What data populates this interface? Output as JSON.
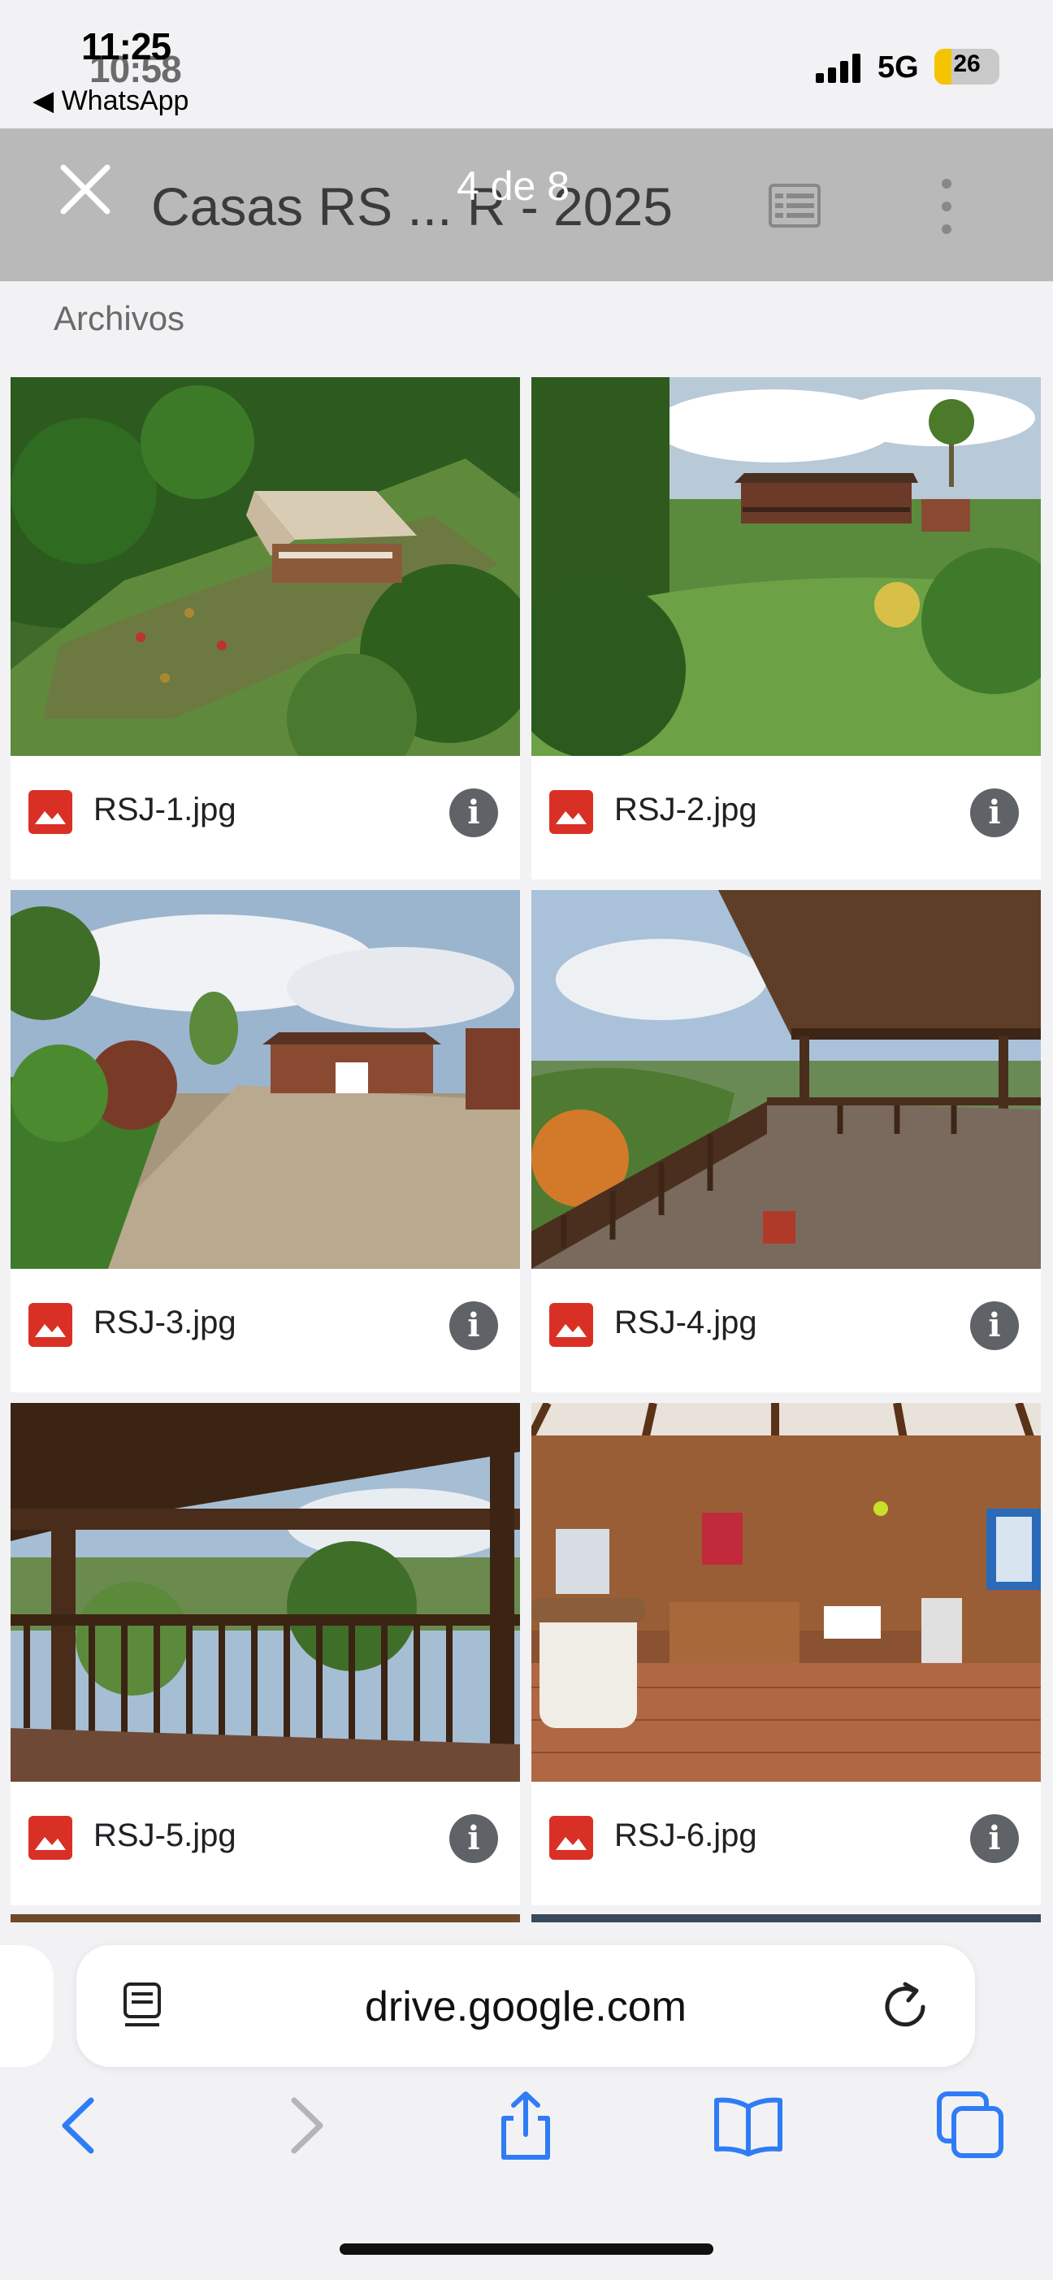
{
  "status_bar": {
    "time": "11:25",
    "time_ghost": "10:58",
    "back_app": "◀ WhatsApp",
    "network": "5G",
    "battery": "26",
    "battery_fraction": 0.26
  },
  "header": {
    "title": "Casas RS ... R - 2025",
    "counter": "4 de 8"
  },
  "section_label": "Archivos",
  "files": [
    {
      "name": "RSJ-1.jpg"
    },
    {
      "name": "RSJ-2.jpg"
    },
    {
      "name": "RSJ-3.jpg"
    },
    {
      "name": "RSJ-4.jpg"
    },
    {
      "name": "RSJ-5.jpg"
    },
    {
      "name": "RSJ-6.jpg"
    }
  ],
  "browser": {
    "url": "drive.google.com"
  },
  "icons": {
    "close": "close-icon",
    "list": "list-view-icon",
    "more": "more-vert-icon",
    "file": "image-file-icon",
    "info": "info-icon",
    "reader": "reader-icon",
    "reload": "reload-icon",
    "back": "back-arrow-icon",
    "forward": "forward-arrow-icon",
    "share": "share-icon",
    "bookmarks": "bookmarks-icon",
    "tabs": "tabs-icon"
  },
  "colors": {
    "accent": "#1a73e8",
    "file_icon": "#d93025",
    "safari_blue": "#2f7cf6"
  }
}
